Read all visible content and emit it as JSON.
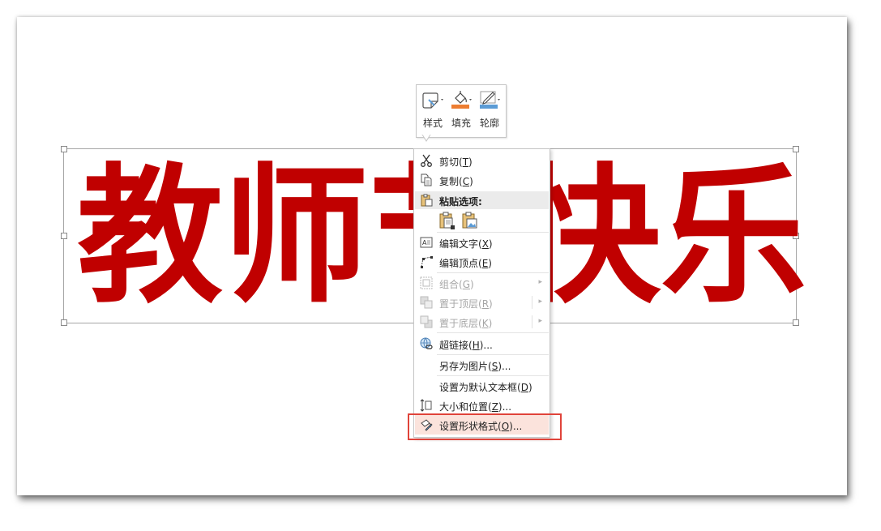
{
  "wordart": {
    "chars": [
      "教",
      "师",
      "节",
      "快",
      "乐"
    ],
    "color": "#c00000"
  },
  "mini_toolbar": {
    "style_label": "样式",
    "fill_label": "填充",
    "outline_label": "轮廓",
    "fill_color": "#ed7d31",
    "outline_color": "#5b9bd5"
  },
  "context_menu": {
    "cut": {
      "label": "剪切(",
      "key": "T",
      "end": ")"
    },
    "copy": {
      "label": "复制(",
      "key": "C",
      "end": ")"
    },
    "paste_options": "粘贴选项:",
    "edit_text": {
      "label": "编辑文字(",
      "key": "X",
      "end": ")"
    },
    "edit_points": {
      "label": "编辑顶点(",
      "key": "E",
      "end": ")"
    },
    "group": {
      "label": "组合(",
      "key": "G",
      "end": ")"
    },
    "bring_to_front": {
      "label": "置于顶层(",
      "key": "R",
      "end": ")"
    },
    "send_to_back": {
      "label": "置于底层(",
      "key": "K",
      "end": ")"
    },
    "hyperlink": {
      "label": "超链接(",
      "key": "H",
      "end": ")..."
    },
    "save_as_picture": {
      "label": "另存为图片(",
      "key": "S",
      "end": ")..."
    },
    "set_default_textbox": {
      "label": "设置为默认文本框(",
      "key": "D",
      "end": ")"
    },
    "size_position": {
      "label": "大小和位置(",
      "key": "Z",
      "end": ")..."
    },
    "format_shape": {
      "label": "设置形状格式(",
      "key": "O",
      "end": ")..."
    }
  },
  "colors": {
    "highlight_box": "#e0433a",
    "hover_bg": "#fbe3dc"
  }
}
